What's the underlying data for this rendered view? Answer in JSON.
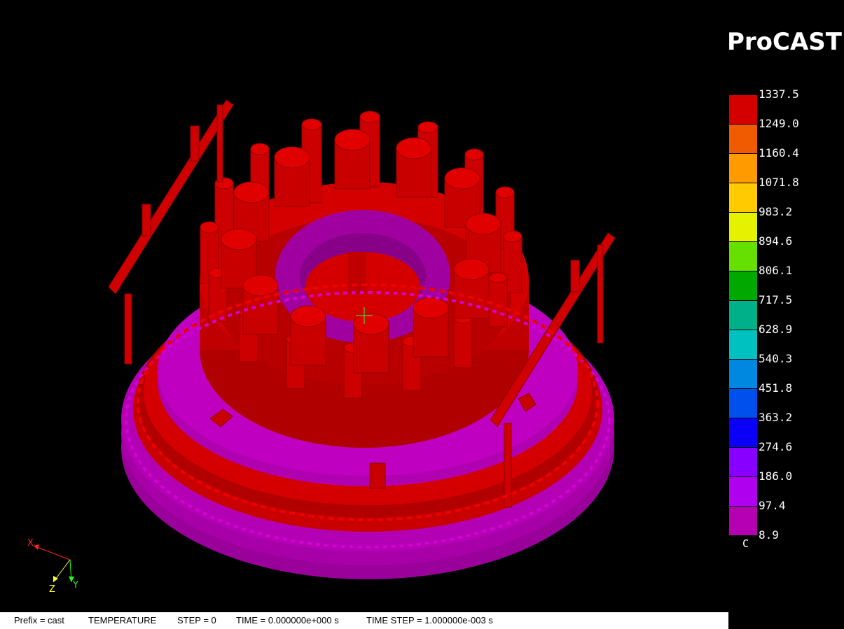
{
  "brand": "ProCAST",
  "legend": {
    "unit": "C",
    "ticks": [
      "1337.5",
      "1249.0",
      "1160.4",
      "1071.8",
      "983.2",
      "894.6",
      "806.1",
      "717.5",
      "628.9",
      "540.3",
      "451.8",
      "363.2",
      "274.6",
      "186.0",
      "97.4",
      "8.9"
    ],
    "colors": [
      "#d40000",
      "#f05a00",
      "#ff9a00",
      "#ffca00",
      "#e4f200",
      "#66e000",
      "#00a800",
      "#00b088",
      "#00c0c0",
      "#0088e0",
      "#0050ee",
      "#0a00f5",
      "#8800ff",
      "#b000f0",
      "#b400b0"
    ]
  },
  "axes": {
    "x": "X",
    "y": "Y",
    "z": "Z"
  },
  "status": {
    "prefix": "Prefix = cast",
    "field": "TEMPERATURE",
    "step": "STEP = 0",
    "time": "TIME = 0.000000e+000 s",
    "time_step": "TIME STEP = 1.000000e-003 s"
  }
}
